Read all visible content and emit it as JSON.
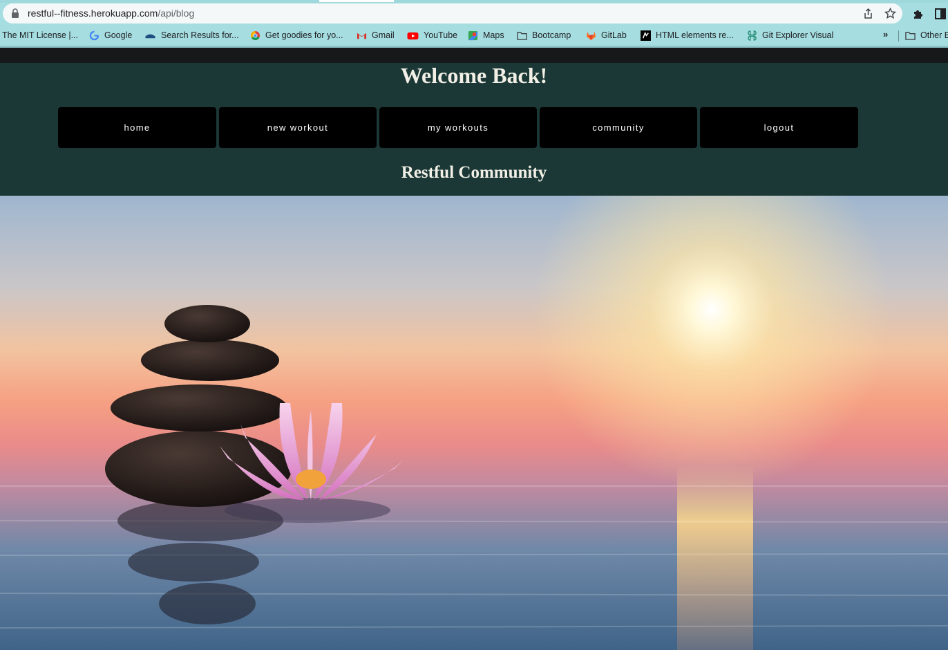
{
  "browser": {
    "url_host": "restful--fitness.herokuapp.com",
    "url_path": "/api/blog",
    "bookmarks": [
      {
        "label": "The MIT License |...",
        "icon": "none"
      },
      {
        "label": "Google",
        "icon": "google-icon"
      },
      {
        "label": "Search Results for...",
        "icon": "bank-icon"
      },
      {
        "label": "Get goodies for yo...",
        "icon": "chrome-icon"
      },
      {
        "label": "Gmail",
        "icon": "gmail-icon"
      },
      {
        "label": "YouTube",
        "icon": "youtube-icon"
      },
      {
        "label": "Maps",
        "icon": "maps-icon"
      },
      {
        "label": "Bootcamp",
        "icon": "folder-icon"
      },
      {
        "label": "GitLab",
        "icon": "gitlab-icon"
      },
      {
        "label": "HTML elements re...",
        "icon": "mdn-icon"
      },
      {
        "label": "Git Explorer Visual",
        "icon": "git-explorer-icon"
      },
      {
        "label": "Other B",
        "icon": "folder-icon"
      }
    ],
    "overflow_label": "»"
  },
  "page": {
    "welcome": "Welcome Back!",
    "nav": [
      {
        "label": "home"
      },
      {
        "label": "new workout"
      },
      {
        "label": "my workouts"
      },
      {
        "label": "community"
      },
      {
        "label": "logout"
      }
    ],
    "section_title": "Restful Community",
    "hero": {
      "subject": "stacked stones and lotus flower on water at sunset"
    }
  },
  "colors": {
    "header_bg": "#1b3836",
    "nav_bg": "#000000",
    "nav_text": "#ffffff",
    "heading_text": "#f1efe6",
    "chrome_bg": "#a6dde0"
  }
}
